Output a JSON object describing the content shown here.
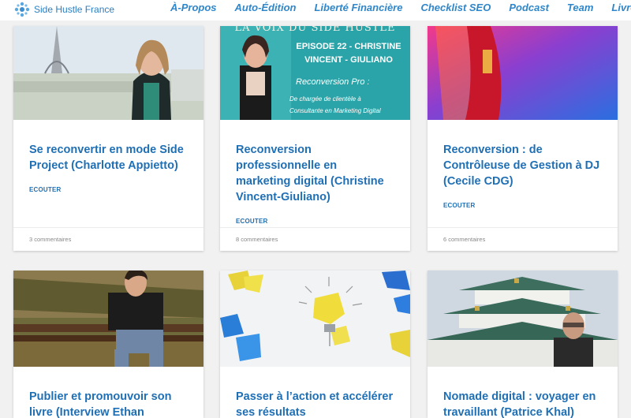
{
  "header": {
    "logo_text": "Side Hustle France",
    "nav": [
      "À-Propos",
      "Auto-Édition",
      "Liberté Financière",
      "Checklist SEO",
      "Podcast",
      "Team",
      "Livres"
    ]
  },
  "cards": [
    {
      "title": "Se reconvertir en mode Side Project (Charlotte Appietto)",
      "link": "ECOUTER",
      "comments": "3 commentaires"
    },
    {
      "title": "Reconversion professionnelle en marketing digital (Christine Vincent-Giuliano)",
      "link": "ECOUTER",
      "comments": "8 commentaires",
      "banner": {
        "line1": "LA VOIX DU SIDE HUSTLE",
        "line2": "EPISODE 22 - CHRISTINE",
        "line3": "VINCENT - GIULIANO",
        "line4": "Reconversion Pro :",
        "line5": "De chargée de clientèle à",
        "line6": "Consultante en Marketing Digital"
      }
    },
    {
      "title": "Reconversion : de Contrôleuse de Gestion à DJ (Cecile CDG)",
      "link": "ECOUTER",
      "comments": "6 commentaires"
    },
    {
      "title": "Publier et promouvoir son livre (Interview Ethan",
      "link": "",
      "comments": ""
    },
    {
      "title": "Passer à l’action et accélérer ses résultats",
      "link": "",
      "comments": ""
    },
    {
      "title": "Nomade digital : voyager en travaillant (Patrice Khal)",
      "link": "",
      "comments": ""
    }
  ],
  "colors": {
    "accent": "#1f6fb5",
    "nav": "#2f86c9",
    "background": "#f1f1f1"
  }
}
